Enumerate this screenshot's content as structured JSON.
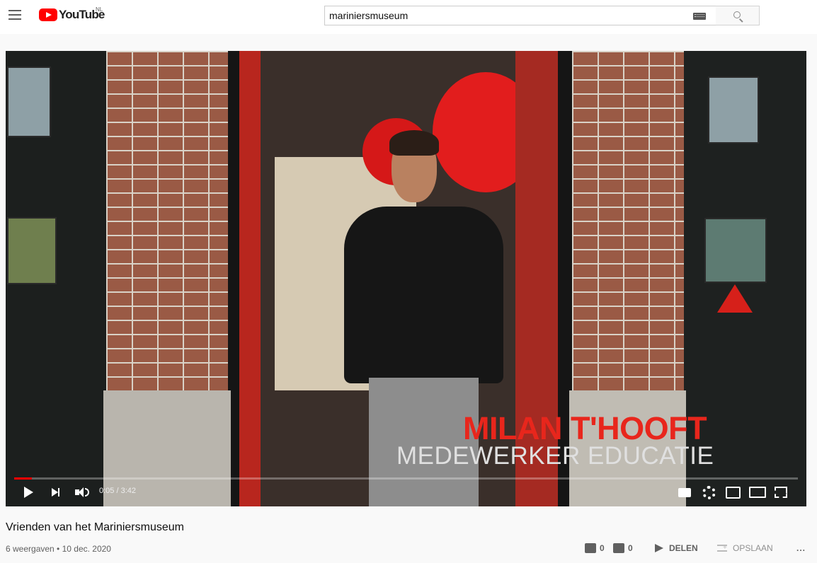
{
  "header": {
    "logo_text": "YouTube",
    "country": "NL",
    "search_value": "mariniersmuseum"
  },
  "video": {
    "overlay_name": "MILAN T'HOOFT",
    "overlay_role": "MEDEWERKER EDUCATIE",
    "time": "0:05 / 3:42",
    "progress": 0.0225
  },
  "info": {
    "title": "Vrienden van het Mariniersmuseum",
    "meta": "6 weergaven • 10 dec. 2020",
    "likes": "0",
    "dislikes": "0",
    "share_label": "DELEN",
    "save_label": "OPSLAAN",
    "more_label": "..."
  },
  "colors": {
    "brand": "#ff0000",
    "accent": "#e8261c"
  }
}
